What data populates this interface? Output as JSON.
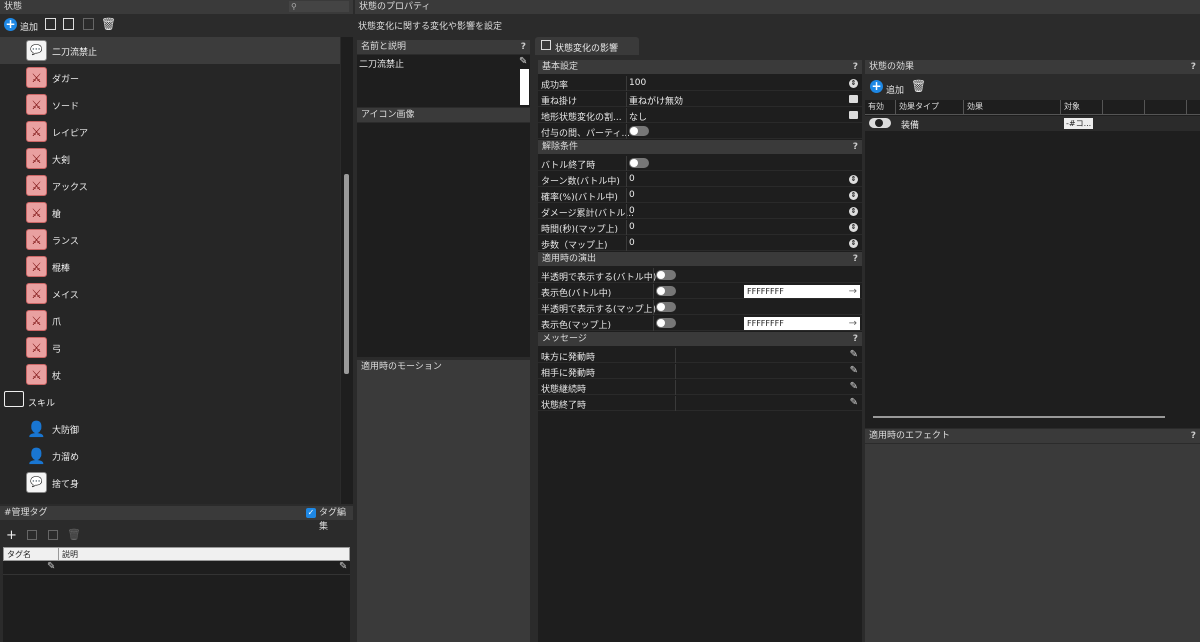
{
  "left": {
    "title": "状態",
    "toolbar": {
      "add_label": "追加"
    },
    "tree_items": [
      {
        "label": "二刀流禁止",
        "icon": "speech-bubble-icon"
      },
      {
        "label": "ダガー",
        "icon": "dagger-icon"
      },
      {
        "label": "ソード",
        "icon": "sword-icon"
      },
      {
        "label": "レイピア",
        "icon": "rapier-icon"
      },
      {
        "label": "大剣",
        "icon": "greatsword-icon"
      },
      {
        "label": "アックス",
        "icon": "axe-icon"
      },
      {
        "label": "槍",
        "icon": "spear-icon"
      },
      {
        "label": "ランス",
        "icon": "lance-icon"
      },
      {
        "label": "棍棒",
        "icon": "club-icon"
      },
      {
        "label": "メイス",
        "icon": "mace-icon"
      },
      {
        "label": "爪",
        "icon": "claw-icon"
      },
      {
        "label": "弓",
        "icon": "bow-icon"
      },
      {
        "label": "杖",
        "icon": "staff-icon"
      },
      {
        "label": "スキル",
        "icon": "folder-icon"
      },
      {
        "label": "大防御",
        "icon": "character-icon"
      },
      {
        "label": "力溜め",
        "icon": "character-icon"
      },
      {
        "label": "捨て身",
        "icon": "speech-bubble-icon"
      }
    ]
  },
  "tags": {
    "title": "#管理タグ",
    "edit_label": "タグ編集",
    "col_name": "タグ名",
    "col_desc": "説明"
  },
  "props": {
    "title": "状態のプロパティ",
    "subtitle": "状態変化に関する変化や影響を設定",
    "name_section": "名前と説明",
    "name_value": "二刀流禁止",
    "icon_section": "アイコン画像",
    "motion_section": "適用時のモーション",
    "tab_label": "状態変化の影響"
  },
  "basic": {
    "header": "基本設定",
    "rows": [
      {
        "label": "成功率",
        "value": "100"
      },
      {
        "label": "重ね掛け",
        "value": "重ねがけ無効"
      },
      {
        "label": "地形状態変化の割...",
        "value": "なし"
      },
      {
        "label": "付与の間、パーティ...",
        "value": ""
      }
    ]
  },
  "release": {
    "header": "解除条件",
    "rows": [
      {
        "label": "バトル終了時",
        "value": ""
      },
      {
        "label": "ターン数(バトル中)",
        "value": "0"
      },
      {
        "label": "確率(%)(バトル中)",
        "value": "0"
      },
      {
        "label": "ダメージ累計(バトル...",
        "value": "0"
      },
      {
        "label": "時間(秒)(マップ上)",
        "value": "0"
      },
      {
        "label": "歩数（マップ上)",
        "value": "0"
      }
    ]
  },
  "presentation": {
    "header": "適用時の演出",
    "rows": [
      {
        "label": "半透明で表示する(バトル中)",
        "value": ""
      },
      {
        "label": "表示色(バトル中)",
        "value": "FFFFFFFF"
      },
      {
        "label": "半透明で表示する(マップ上)",
        "value": ""
      },
      {
        "label": "表示色(マップ上)",
        "value": "FFFFFFFF"
      }
    ]
  },
  "message": {
    "header": "メッセージ",
    "rows": [
      {
        "label": "味方に発動時"
      },
      {
        "label": "相手に発動時"
      },
      {
        "label": "状態継続時"
      },
      {
        "label": "状態終了時"
      }
    ]
  },
  "effects": {
    "title": "状態の効果",
    "add_label": "追加",
    "columns": [
      "有効",
      "効果タイプ",
      "効果",
      "対象"
    ],
    "rows": [
      {
        "type": "装備",
        "effect": "",
        "target": "-#コ..."
      }
    ],
    "effect_section": "適用時のエフェクト"
  },
  "colors": {
    "accent": "#1e88e5",
    "icon_pink": "#e9a0a0"
  }
}
